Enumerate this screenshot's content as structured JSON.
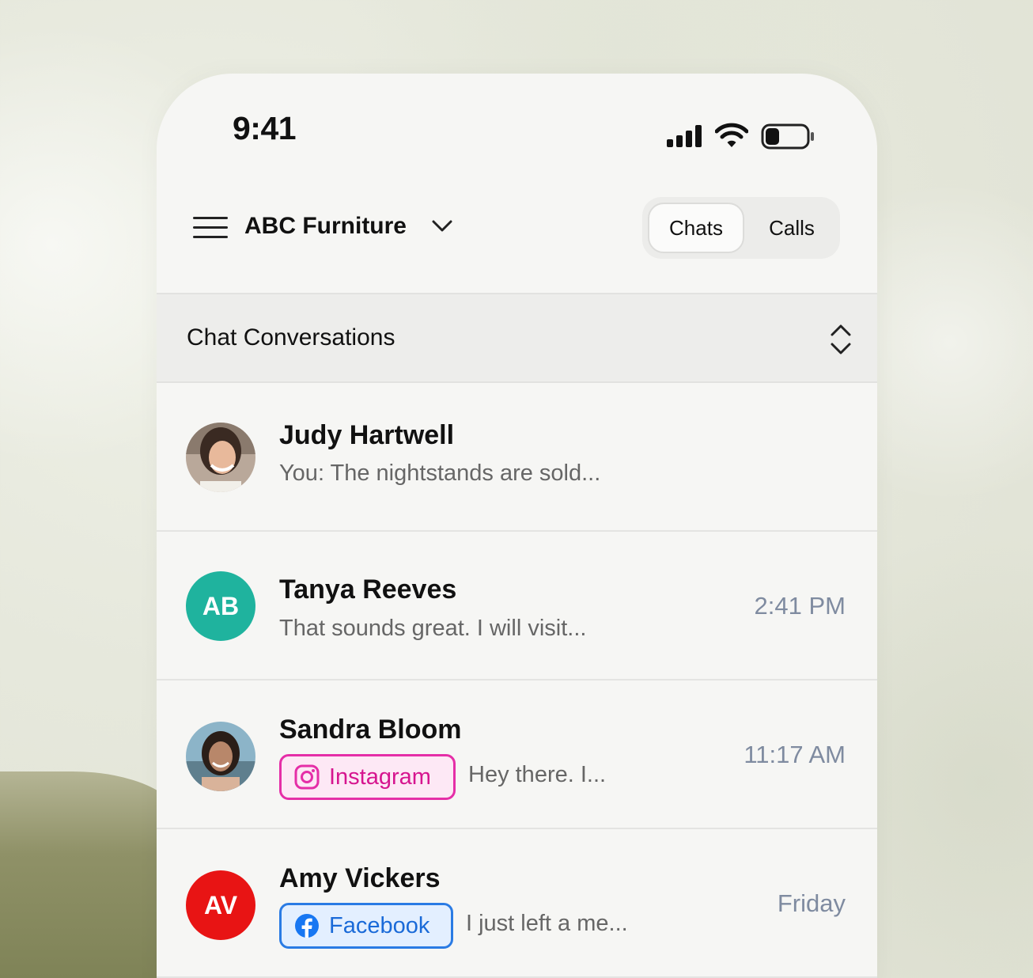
{
  "status_bar": {
    "time": "9:41"
  },
  "header": {
    "account_name": "ABC Furniture",
    "tabs": [
      {
        "label": "Chats",
        "selected": true
      },
      {
        "label": "Calls",
        "selected": false
      }
    ]
  },
  "section": {
    "title": "Chat Conversations"
  },
  "conversations": [
    {
      "name": "Judy Hartwell",
      "preview": "You: The nightstands are sold...",
      "time": "",
      "avatar": "photo"
    },
    {
      "name": "Tanya Reeves",
      "preview": "That sounds great. I will visit...",
      "time": "2:41 PM",
      "initials": "AB",
      "avatar_color": "#1fb39e"
    },
    {
      "name": "Sandra Bloom",
      "channel": "Instagram",
      "preview": "Hey there. I...",
      "time": "11:17 AM",
      "avatar": "photo"
    },
    {
      "name": "Amy Vickers",
      "channel": "Facebook",
      "preview": "I just left a me...",
      "time": "Friday",
      "initials": "AV",
      "avatar_color": "#e81414"
    }
  ],
  "colors": {
    "instagram": "#e52ea7",
    "facebook": "#2a7be4",
    "time_text": "#7f8ba0"
  }
}
